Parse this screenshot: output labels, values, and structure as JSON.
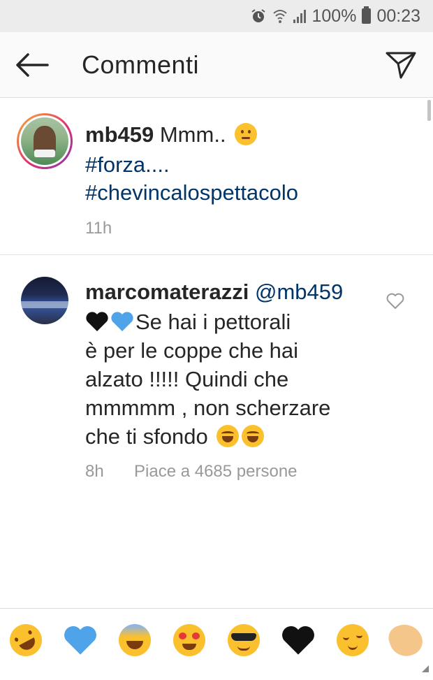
{
  "status_bar": {
    "battery": "100%",
    "time": "00:23",
    "icons": [
      "alarm-icon",
      "wifi-icon",
      "signal-icon",
      "battery-icon"
    ]
  },
  "app_bar": {
    "title": "Commenti",
    "back_icon": "arrow-left-icon",
    "send_icon": "paper-plane-icon"
  },
  "caption": {
    "username": "mb459",
    "text": "Mmm..",
    "emoji": "thinking-face-emoji",
    "hashtags": [
      "#forza....",
      "#chevincalospettacolo"
    ],
    "time": "11h"
  },
  "reply": {
    "username": "marcomaterazzi",
    "mention": "@mb459",
    "hearts": [
      "black-heart-emoji",
      "blue-heart-emoji"
    ],
    "text_lines": [
      "Se hai i pettorali",
      "è per le coppe che hai",
      "alzato !!!!! Quindi che",
      "mmmmm , non scherzare",
      "che ti sfondo"
    ],
    "trailing_emojis": [
      "tears-of-joy-emoji",
      "tears-of-joy-emoji"
    ],
    "time": "8h",
    "likes": "Piace a 4685 persone"
  },
  "emoji_bar": [
    "rolling-on-floor-laughing-emoji",
    "blue-heart-emoji",
    "grinning-sweat-emoji",
    "heart-eyes-emoji",
    "sunglasses-emoji",
    "black-heart-emoji",
    "relieved-face-emoji",
    "clapping-hands-emoji"
  ],
  "colors": {
    "link": "#003569",
    "meta": "#999999",
    "blue_heart": "#4fa3e8",
    "black_heart": "#111111",
    "emoji_yellow": "#fbc02d"
  }
}
